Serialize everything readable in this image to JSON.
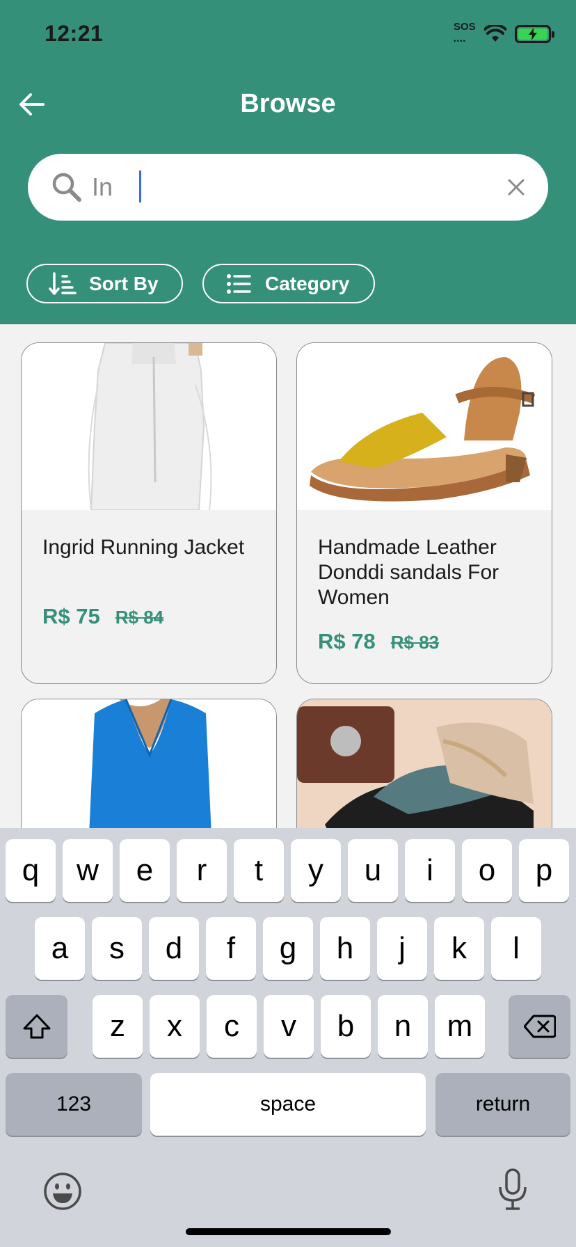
{
  "status": {
    "time": "12:21",
    "sos": "SOS",
    "icons": [
      "signal-dots-icon",
      "wifi-icon",
      "battery-charging-icon"
    ]
  },
  "header": {
    "title": "Browse",
    "back_icon": "arrow-left-icon"
  },
  "search": {
    "value": "In",
    "icon": "search-icon",
    "clear_icon": "close-icon"
  },
  "filters": {
    "sort_label": "Sort By",
    "category_label": "Category"
  },
  "products": [
    {
      "name": "Ingrid Running Jacket",
      "price": "R$ 75",
      "old_price": "R$ 84"
    },
    {
      "name": "Handmade Leather Donddi sandals For Women",
      "price": "R$ 78",
      "old_price": "R$ 83"
    },
    {
      "name": "",
      "price": "",
      "old_price": ""
    },
    {
      "name": "",
      "price": "",
      "old_price": ""
    }
  ],
  "keyboard": {
    "row1": [
      "q",
      "w",
      "e",
      "r",
      "t",
      "y",
      "u",
      "i",
      "o",
      "p"
    ],
    "row2": [
      "a",
      "s",
      "d",
      "f",
      "g",
      "h",
      "j",
      "k",
      "l"
    ],
    "row3": [
      "z",
      "x",
      "c",
      "v",
      "b",
      "n",
      "m"
    ],
    "numbers_label": "123",
    "space_label": "space",
    "return_label": "return"
  },
  "colors": {
    "brand": "#35907a",
    "background": "#f2f2f2",
    "keyboard_bg": "#d1d4db"
  }
}
